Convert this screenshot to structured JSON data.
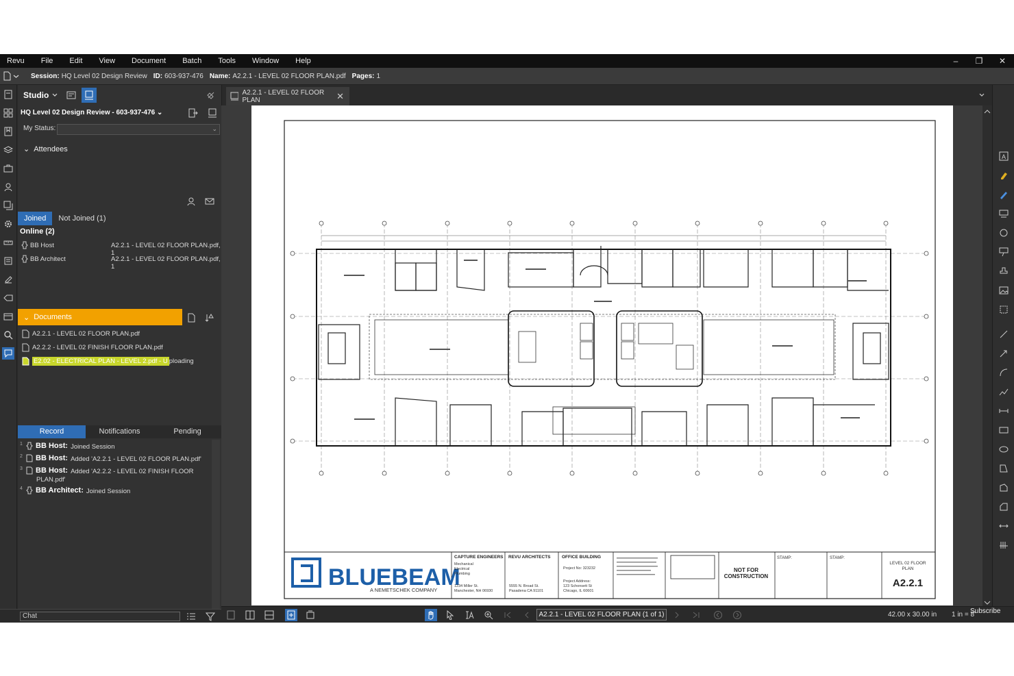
{
  "menu": [
    "Revu",
    "File",
    "Edit",
    "View",
    "Document",
    "Batch",
    "Tools",
    "Window",
    "Help"
  ],
  "window_controls": [
    "–",
    "❐",
    "✕"
  ],
  "session_bar": {
    "session_label": "Session:",
    "session_value": "HQ Level 02 Design Review",
    "id_label": "ID:",
    "id_value": "603-937-476",
    "name_label": "Name:",
    "name_value": "A2.2.1 - LEVEL 02 FLOOR PLAN.pdf",
    "pages_label": "Pages:",
    "pages_value": "1"
  },
  "studio": {
    "title": "Studio",
    "session_name": "HQ Level 02 Design Review - 603-937-476",
    "my_status_label": "My Status:",
    "my_status_value": "",
    "attendees_label": "Attendees",
    "tabs": {
      "joined": "Joined",
      "not_joined": "Not Joined (1)"
    },
    "online_label": "Online (2)",
    "attendees": [
      {
        "name": "BB Host",
        "doc": "A2.2.1 - LEVEL 02 FLOOR PLAN.pdf, 1"
      },
      {
        "name": "BB Architect",
        "doc": "A2.2.1 - LEVEL 02 FLOOR PLAN.pdf, 1"
      }
    ],
    "documents_label": "Documents",
    "documents": [
      {
        "name": "A2.2.1 - LEVEL 02 FLOOR PLAN.pdf",
        "suffix": ""
      },
      {
        "name": "A2.2.2 - LEVEL 02 FINISH FLOOR PLAN.pdf",
        "suffix": ""
      },
      {
        "name": "E2.02 - ELECTRICAL PLAN - LEVEL 2.pdf - U",
        "suffix": "ploading"
      }
    ],
    "record_tabs": {
      "record": "Record",
      "notifications": "Notifications",
      "pending": "Pending"
    },
    "record": [
      {
        "num": "1",
        "who": "BB Host:",
        "what": "Joined Session",
        "what2": ""
      },
      {
        "num": "2",
        "who": "BB Host:",
        "what": "Added 'A2.2.1 - LEVEL 02 FLOOR PLAN.pdf'",
        "what2": ""
      },
      {
        "num": "3",
        "who": "BB Host:",
        "what": "Added 'A2.2.2 - LEVEL 02 FINISH FLOOR",
        "what2": "PLAN.pdf'"
      },
      {
        "num": "4",
        "who": "BB Architect:",
        "what": "Joined Session",
        "what2": ""
      }
    ],
    "chat_placeholder": "Chat"
  },
  "doc_tab": {
    "label": "A2.2.1 - LEVEL 02 FLOOR PLAN",
    "close": "✕"
  },
  "title_block": {
    "logo_text": "BLUEBEAM",
    "logo_sub": "A NEMETSCHEK COMPANY",
    "engineer_title": "CAPTURE ENGINEERS",
    "engineer_lines": [
      "Mechanical",
      "Electrical",
      "Plumbing"
    ],
    "engineer_addr": [
      "1234 Miller St.",
      "Manchester, NH 06930"
    ],
    "architect_title": "REVU ARCHITECTS",
    "architect_addr": [
      "5555 N. Broad St.",
      "Pasadena CA 91101"
    ],
    "building_title": "OFFICE BUILDING",
    "project_no": "Project No: 323232",
    "project_addr": [
      "Project Address:",
      "123 Schonsett St",
      "Chicago, IL 60601"
    ],
    "nfc": [
      "NOT FOR",
      "CONSTRUCTION"
    ],
    "stamp1": "STAMP:",
    "stamp2": "STAMP:",
    "sheet_title": [
      "LEVEL 02 FLOOR",
      "PLAN"
    ],
    "sheet_number": "A2.2.1"
  },
  "bottom": {
    "page_select": "A2.2.1 - LEVEL 02 FLOOR PLAN (1 of 1)",
    "dimensions": "42.00 x 30.00 in",
    "scale": "1 in = 8'",
    "subscribe": "Subscribe"
  },
  "colors": {
    "accent": "#2f6db5",
    "documents_bar": "#f2a100",
    "uploading": "#c8d62c",
    "bluebeam": "#1d5fa8"
  }
}
